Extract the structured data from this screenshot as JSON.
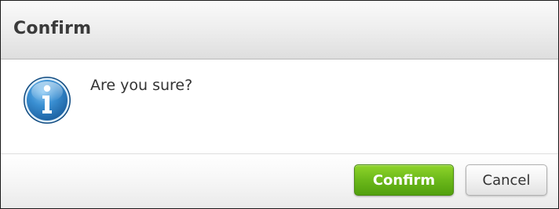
{
  "dialog": {
    "title": "Confirm",
    "message": "Are you sure?",
    "icon": "info-icon",
    "confirm_label": "Confirm",
    "cancel_label": "Cancel"
  },
  "colors": {
    "confirm_button": "#6bb81a",
    "icon_blue": "#2f82c8",
    "title_text": "#3a3a3a"
  }
}
